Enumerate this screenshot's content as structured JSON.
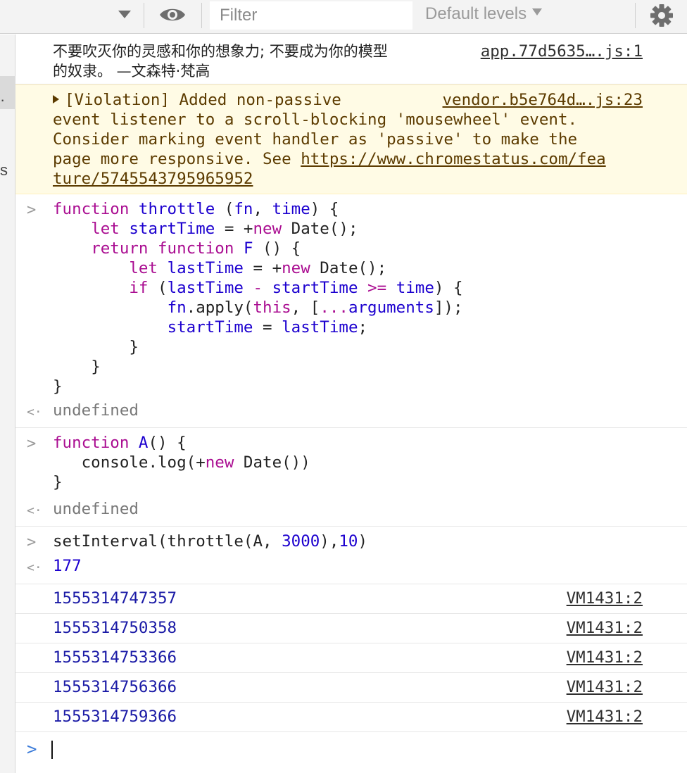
{
  "toolbar": {
    "filter_placeholder": "Filter",
    "filter_value": "",
    "levels_label": "Default levels",
    "icons": [
      "chevron-down-icon",
      "eye-icon",
      "gear-icon"
    ]
  },
  "sidebar": {
    "glyph_1": "·",
    "glyph_2": "s"
  },
  "messages": {
    "log1": {
      "text_line1": "不要吹灭你的灵感和你的想象力; 不要成为你的模型",
      "text_line2": "的奴隶。 —文森特·梵高",
      "source": "app.77d5635….js:1"
    },
    "violation": {
      "line1": "[Violation] Added non-passive",
      "line2": "event listener to a scroll-blocking 'mousewheel' event.",
      "line3": "Consider marking event handler as 'passive' to make the",
      "line4_prefix": "page more responsive. See ",
      "link_part1": "https://www.chromestatus.com/fea",
      "link_part2": "ture/5745543795965952",
      "source": "vendor.b5e764d….js:23"
    },
    "throttle_code": {
      "l1_kw": "function",
      "l1_name": "throttle",
      "l1_p1": " (",
      "l1_arg1": "fn",
      "l1_p2": ", ",
      "l1_arg2": "time",
      "l1_p3": ") {",
      "l2_kw": "let",
      "l2_var": "startTime",
      "l2_op": " = +",
      "l2_new": "new",
      "l2_rest": " Date();",
      "l3_kw": "return",
      "l3_kw2": "function",
      "l3_name": "F",
      "l3_rest": " () {",
      "l4_kw": "let",
      "l4_var": "lastTime",
      "l4_op": " = +",
      "l4_new": "new",
      "l4_rest": " Date();",
      "l5_kw": "if",
      "l5_p1": " (",
      "l5_a": "lastTime",
      "l5_op1": " - ",
      "l5_b": "startTime",
      "l5_op2": " >= ",
      "l5_c": "time",
      "l5_p2": ") {",
      "l6_a": "fn",
      "l6_b": ".apply(",
      "l6_this": "this",
      "l6_c": ", [",
      "l6_dots": "...",
      "l6_args": "arguments",
      "l6_d": "]);",
      "l7_a": "startTime",
      "l7_op": " = ",
      "l7_b": "lastTime",
      "l7_c": ";",
      "l8": "}",
      "l9": "}",
      "l10": "}"
    },
    "result1": "undefined",
    "a_code": {
      "l1_kw": "function",
      "l1_name": "A",
      "l1_rest": "() {",
      "l2_a": "console.log(+",
      "l2_new": "new",
      "l2_b": " Date())",
      "l3": "}"
    },
    "result2": "undefined",
    "set_interval": {
      "a": "setInterval(throttle(A, ",
      "n1": "3000",
      "b": "),",
      "n2": "10",
      "c": ")"
    },
    "result3": "177",
    "logs": [
      {
        "value": "1555314747357",
        "source": "VM1431:2"
      },
      {
        "value": "1555314750358",
        "source": "VM1431:2"
      },
      {
        "value": "1555314753366",
        "source": "VM1431:2"
      },
      {
        "value": "1555314756366",
        "source": "VM1431:2"
      },
      {
        "value": "1555314759366",
        "source": "VM1431:2"
      }
    ]
  },
  "prompts": {
    "input": ">",
    "output": "<·"
  }
}
